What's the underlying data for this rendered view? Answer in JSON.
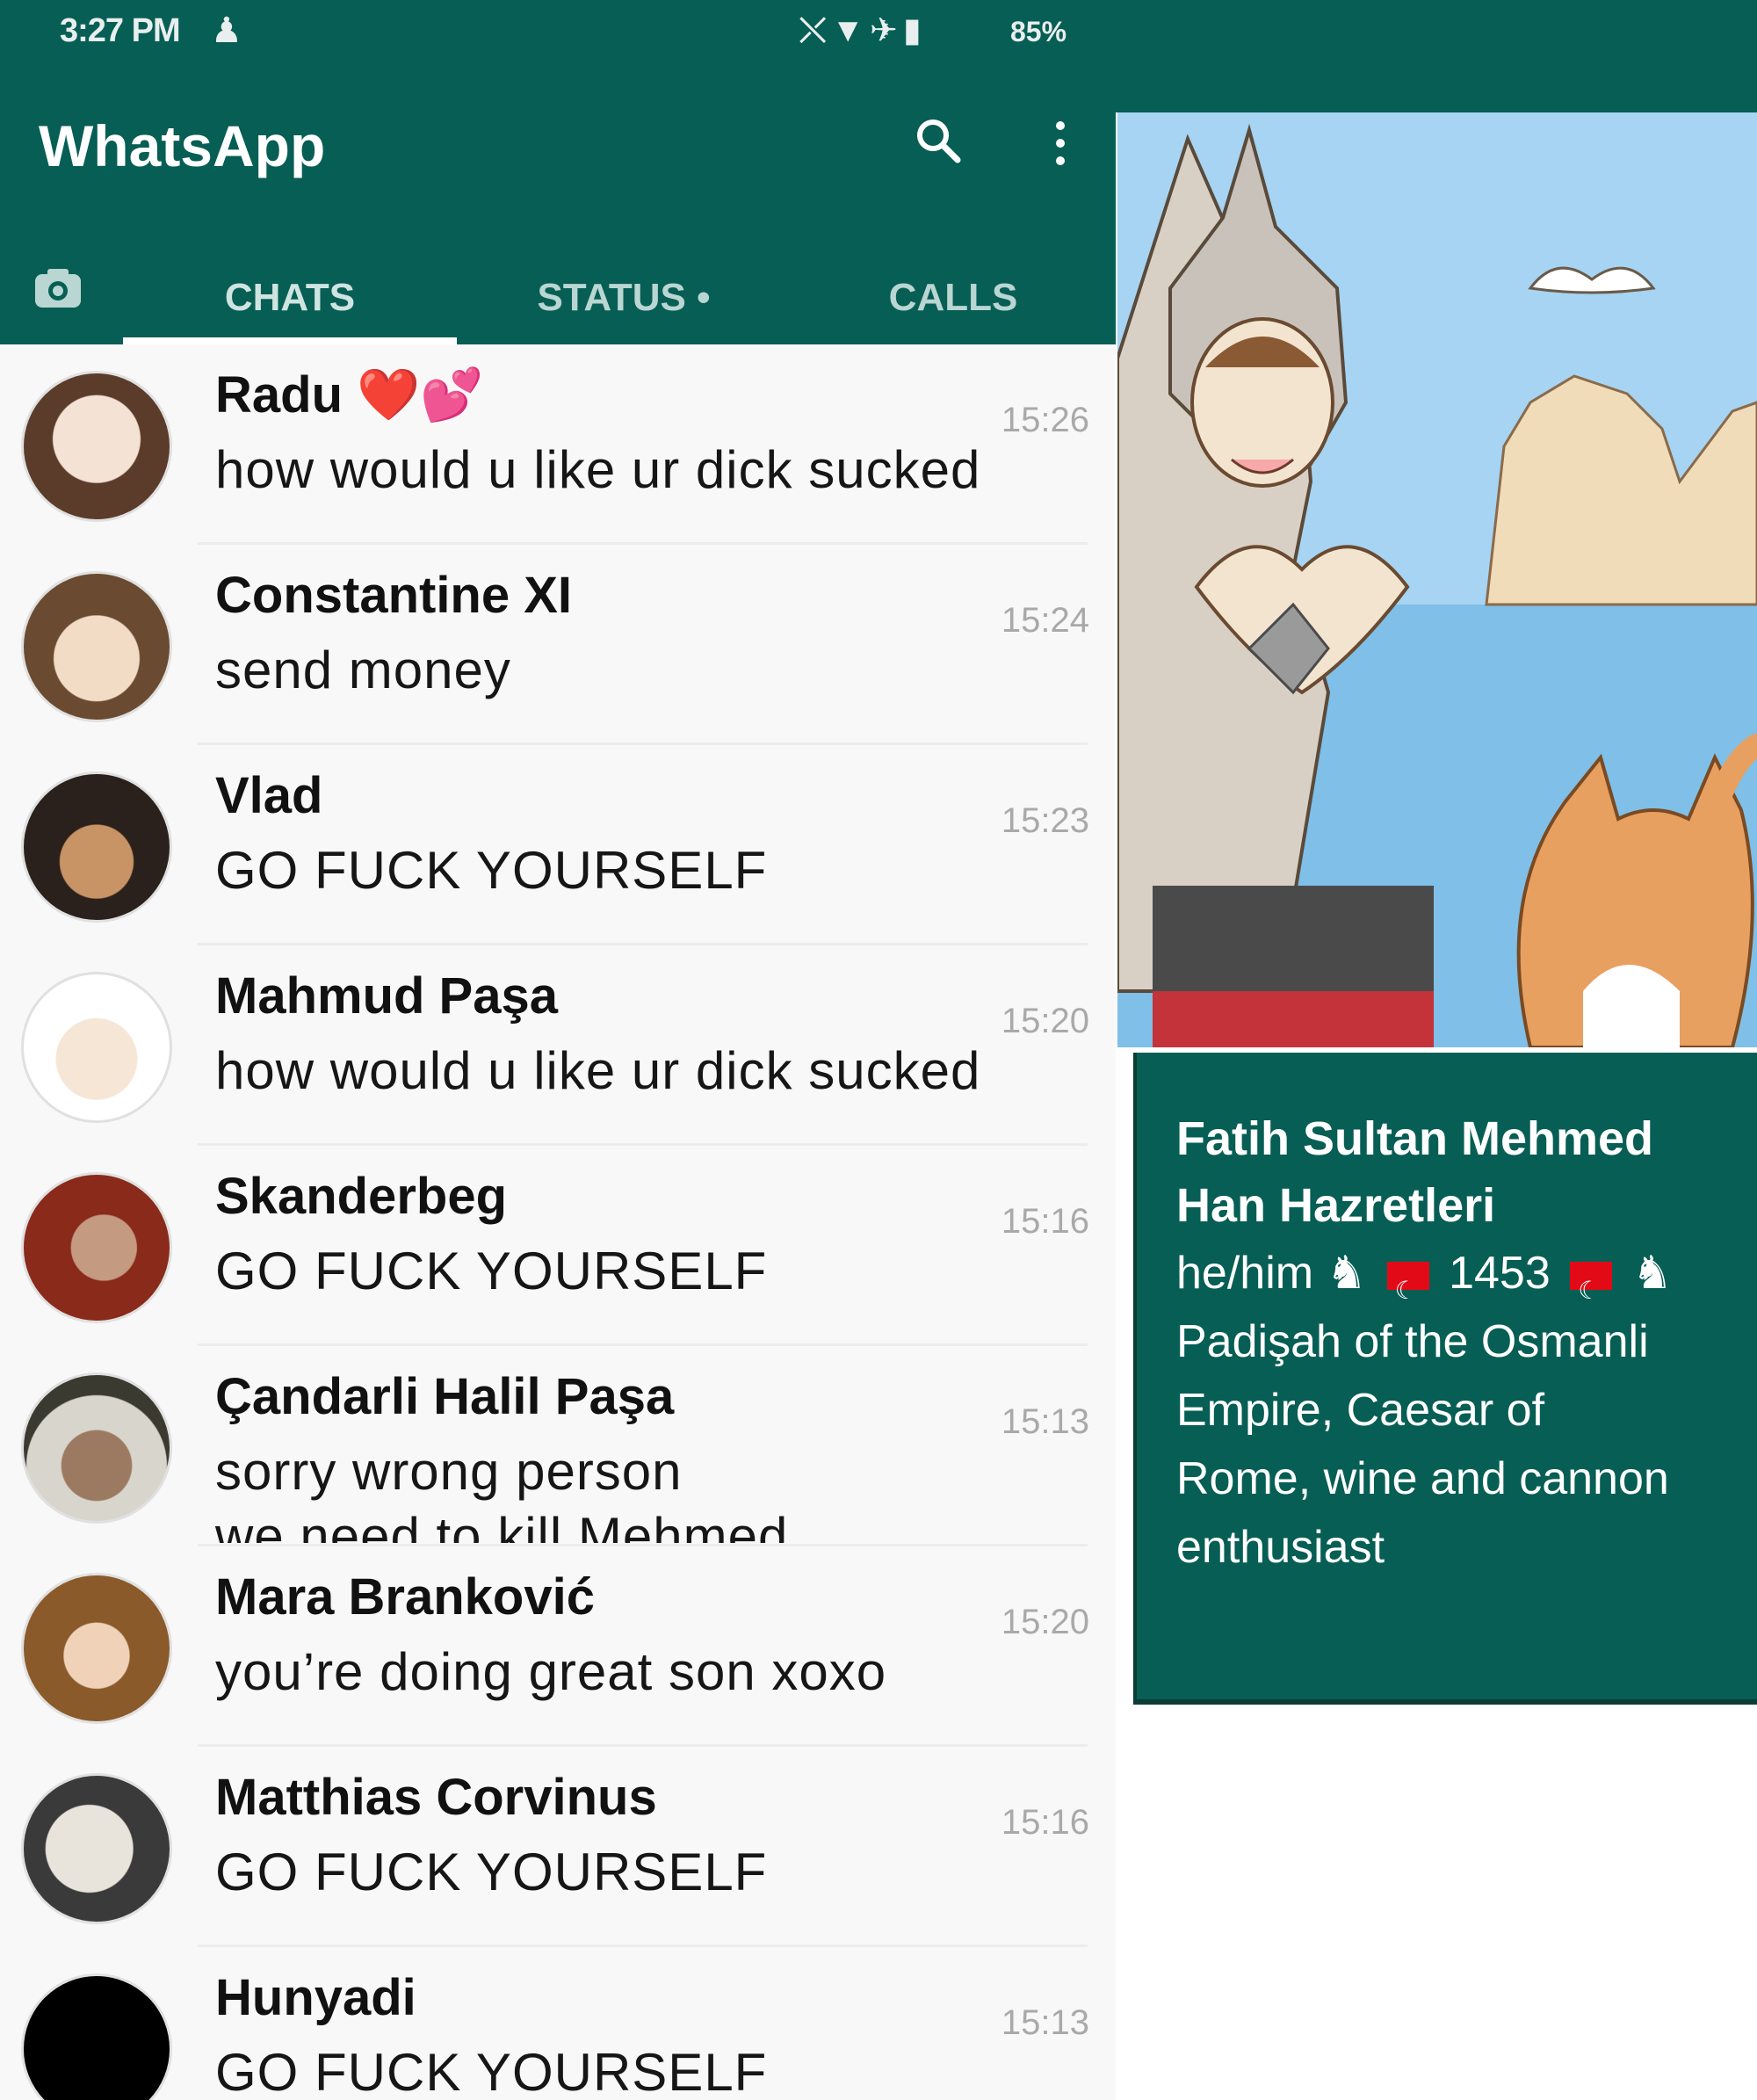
{
  "status_bar": {
    "time": "3:27 PM",
    "battery": "85%"
  },
  "app": {
    "title": "WhatsApp"
  },
  "tabs": {
    "chats": "CHATS",
    "status": "STATUS •",
    "calls": "CALLS"
  },
  "chats": [
    {
      "name": "Radu ❤️💕",
      "message": "how would u like ur dick sucked",
      "time": "15:26"
    },
    {
      "name": "Constantine XI",
      "message": "send money",
      "time": "15:24"
    },
    {
      "name": "Vlad",
      "message": "GO FUCK YOURSELF",
      "time": "15:23"
    },
    {
      "name": "Mahmud Paşa",
      "message": "how would u like ur dick sucked",
      "time": "15:20"
    },
    {
      "name": "Skanderbeg",
      "message": "GO FUCK YOURSELF",
      "time": "15:16"
    },
    {
      "name": "Çandarli Halil Paşa",
      "message": "sorry wrong person",
      "message2": "we need to kill Mehmed",
      "time": "15:13"
    },
    {
      "name": "Mara Branković",
      "message": "you’re doing great son xoxo",
      "time": "15:20"
    },
    {
      "name": "Matthias Corvinus",
      "message": "GO FUCK YOURSELF",
      "time": "15:16"
    },
    {
      "name": "Hunyadi",
      "message": "GO FUCK YOURSELF",
      "time": "15:13"
    }
  ],
  "profile": {
    "name_line1": "Fatih Sultan Mehmed",
    "name_line2": "Han Hazretleri",
    "pronouns": "he/him",
    "year": "1453",
    "bio_line1": "Padişah of the Osmanli",
    "bio_line2": "Empire, Caesar of",
    "bio_line3": "Rome, wine and cannon",
    "bio_line4": "enthusiast"
  },
  "colors": {
    "header_green": "#075e54",
    "time_gray": "#a9a9a9"
  },
  "icons": [
    "search-icon",
    "menu-icon",
    "camera-icon",
    "horse-icon",
    "turkey-flag-icon"
  ]
}
